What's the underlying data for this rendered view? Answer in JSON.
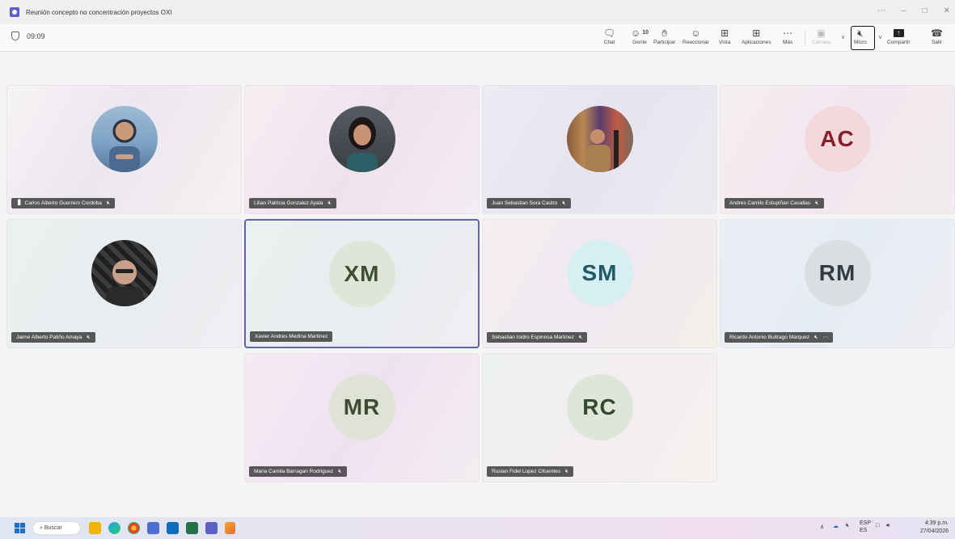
{
  "window": {
    "title": "Reunión concepto no concentración proyectos OXI",
    "controls": [
      "⋯",
      "–",
      "□",
      "✕"
    ]
  },
  "toolbar": {
    "timer": "09:09",
    "chat_label": "Chat",
    "people_label": "Gente",
    "people_count": "10",
    "raise_label": "Participar",
    "react_label": "Reaccionar",
    "view_label": "Vista",
    "apps_label": "Aplicaciones",
    "more_label": "Más",
    "camera_label": "Cámara",
    "mic_label": "Micro",
    "share_label": "Compartir",
    "leave_label": "Salir"
  },
  "participants": [
    {
      "name": "Carlos Alberto Guerrero Cordoba",
      "initials": "",
      "photo": true,
      "signal": "▐▌",
      "avatar_color": "#7fa4c5"
    },
    {
      "name": "Lilian Patricia Gonzalez Ayala",
      "initials": "",
      "photo": true,
      "avatar_color": "#3a3f44"
    },
    {
      "name": "Juan Sebastian Sora Castro",
      "initials": "",
      "photo": true,
      "avatar_color": "#6b5a48"
    },
    {
      "name": "Andres Camilo Estupiñan Casallas",
      "initials": "AC",
      "photo": false,
      "avatar_color": "#f2d9dc",
      "text_color": "#8a1c2b"
    },
    {
      "name": "Jaime Alberto Patiño Amaya",
      "initials": "",
      "photo": true,
      "avatar_color": "#2e2e2e"
    },
    {
      "name": "Xavier Andres Medina Martinez",
      "initials": "XM",
      "photo": false,
      "avatar_color": "#dfe6d8",
      "text_color": "#3f4f33"
    },
    {
      "name": "Sebastian Isidro Espinosa Martinez",
      "initials": "SM",
      "photo": false,
      "avatar_color": "#d7eef2",
      "text_color": "#1f5a66"
    },
    {
      "name": "Ricardo Antonio Buitrago Marquez",
      "initials": "RM",
      "photo": false,
      "avatar_color": "#d9dee3",
      "text_color": "#2f3b45",
      "more": "⋯"
    },
    {
      "name": "Maria Camila Barragan Rodriguez",
      "initials": "MR",
      "photo": false,
      "avatar_color": "#dfe3d6",
      "text_color": "#3f4a30"
    },
    {
      "name": "Ruslan Fidel Lopez Cifuentes",
      "initials": "RC",
      "photo": false,
      "avatar_color": "#dde6d9",
      "text_color": "#334a30"
    }
  ],
  "taskbar": {
    "search_label": "Buscar",
    "lang": "ESP",
    "lang_sub": "ES",
    "time": "4:39 p.m.",
    "date": "27/04/2026"
  }
}
